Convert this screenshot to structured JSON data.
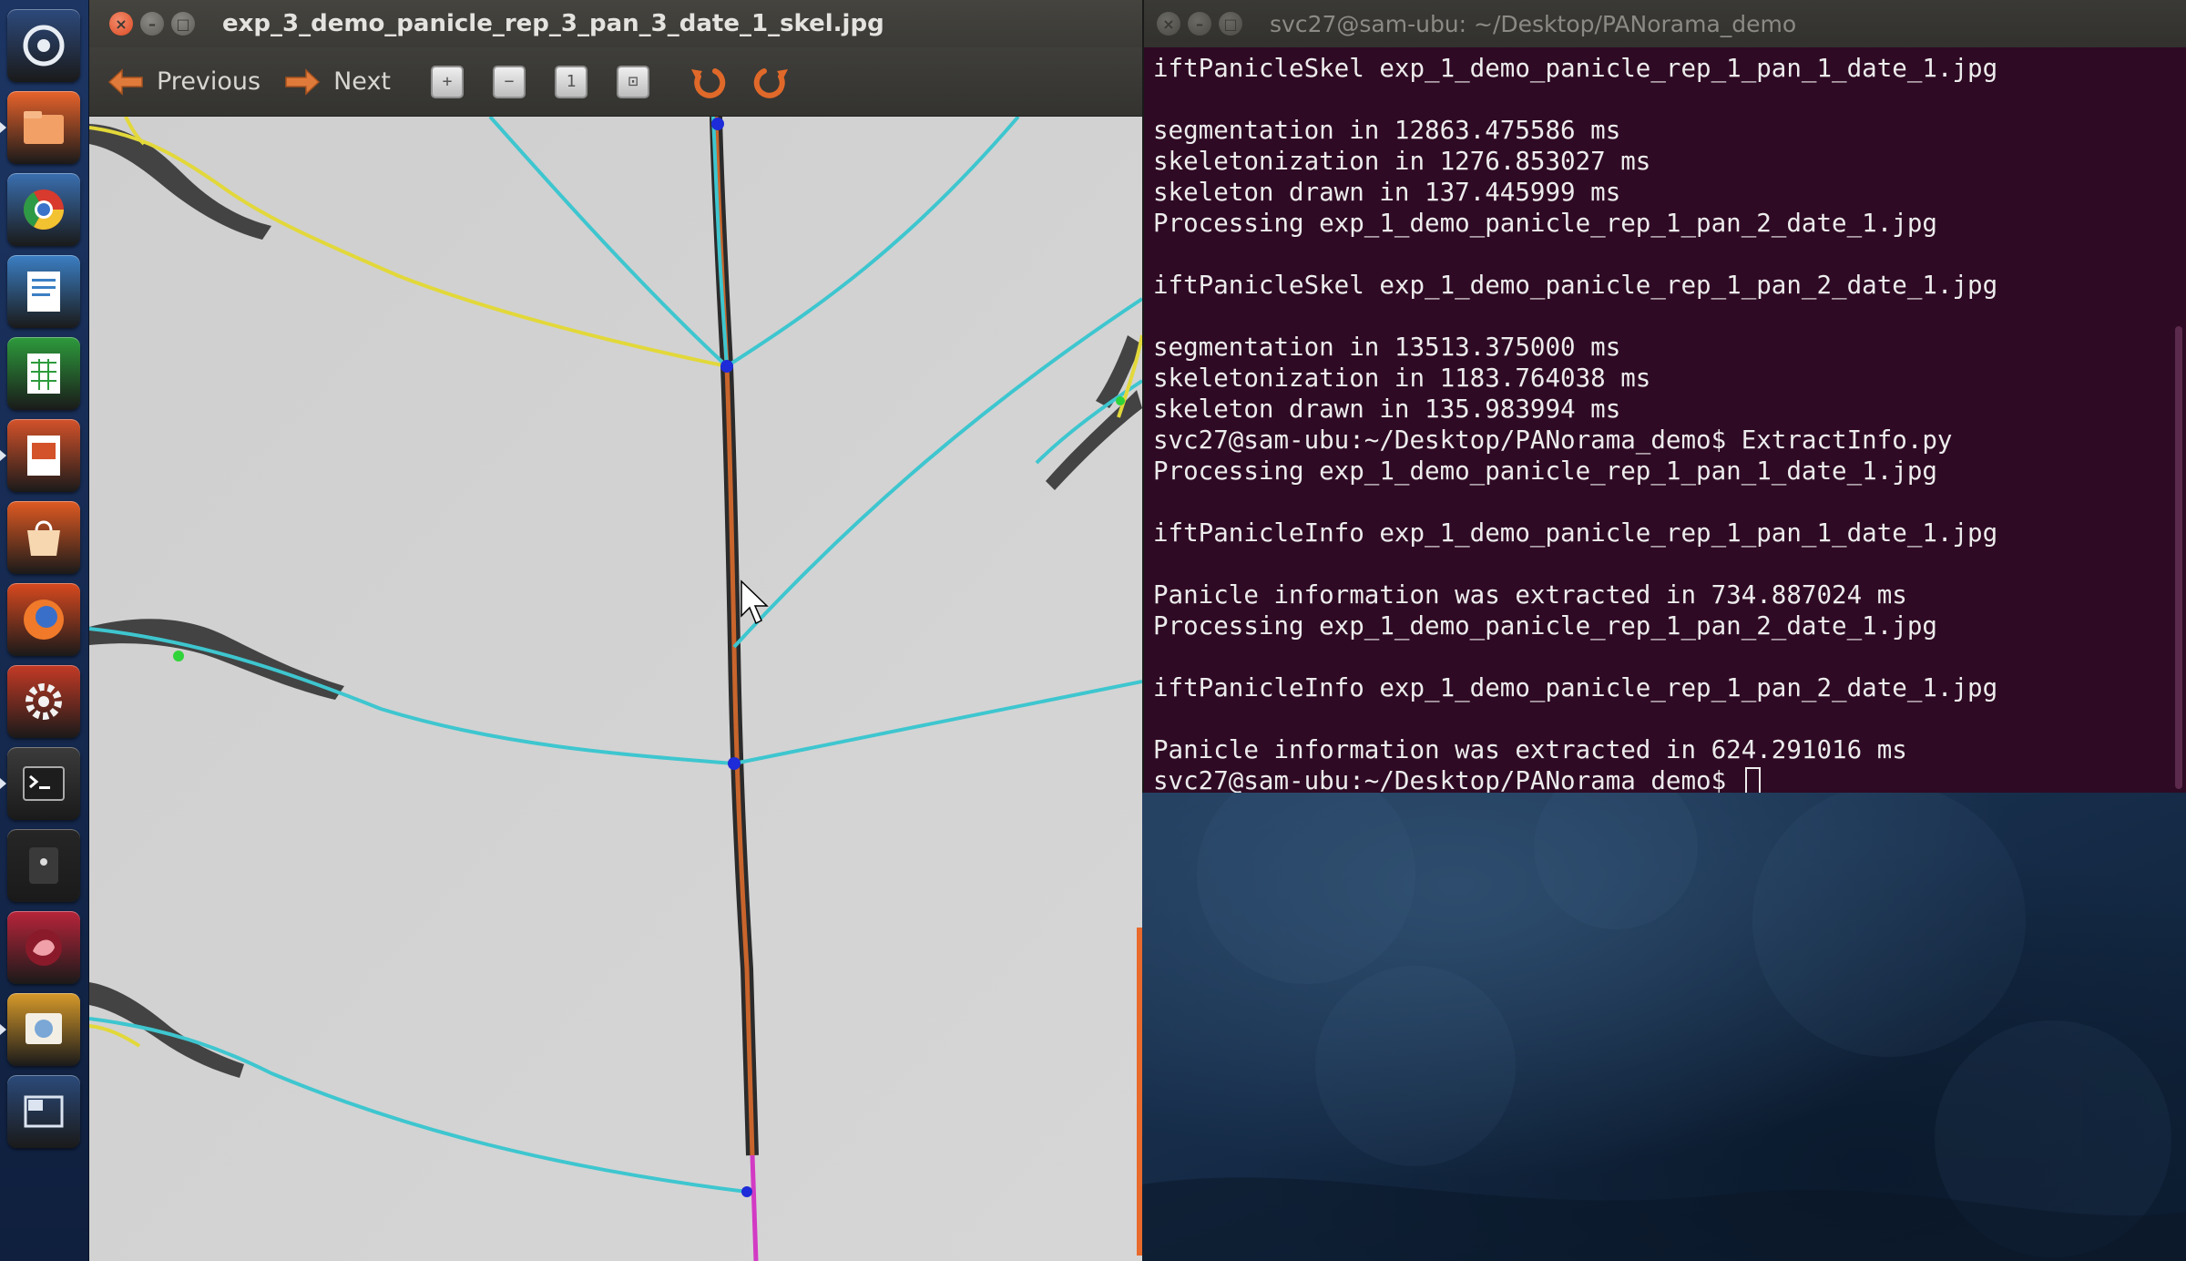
{
  "launcher": {
    "items": [
      {
        "name": "dash-home-icon",
        "color": "#2d4a7c"
      },
      {
        "name": "files-icon",
        "color": "#e8632b"
      },
      {
        "name": "chrome-icon",
        "color": "#3a6fb0"
      },
      {
        "name": "writer-icon",
        "color": "#3b7fc4"
      },
      {
        "name": "calc-icon",
        "color": "#2d9b3c"
      },
      {
        "name": "impress-icon",
        "color": "#d4522a"
      },
      {
        "name": "software-center-icon",
        "color": "#e05a22"
      },
      {
        "name": "firefox-icon",
        "color": "#d8491f"
      },
      {
        "name": "settings-icon",
        "color": "#c43a25"
      },
      {
        "name": "terminal-icon",
        "color": "#3b3b3b"
      },
      {
        "name": "camera-icon",
        "color": "#262626"
      },
      {
        "name": "app-icon",
        "color": "#b8243a"
      },
      {
        "name": "image-viewer-icon",
        "color": "#d79a2a"
      },
      {
        "name": "workspace-switcher-icon",
        "color": "#2b4a7a"
      }
    ]
  },
  "viewer": {
    "title": "exp_3_demo_panicle_rep_3_pan_3_date_1_skel.jpg",
    "toolbar": {
      "previous_label": "Previous",
      "next_label": "Next",
      "zoom_in_icon": "zoom-in-icon",
      "zoom_out_icon": "zoom-out-icon",
      "zoom_normal_icon": "zoom-normal-icon",
      "zoom_fit_icon": "zoom-fit-icon",
      "rotate_left_icon": "rotate-left-icon",
      "rotate_right_icon": "rotate-right-icon"
    },
    "colors": {
      "main_axis": "#c9652c",
      "primary_branch": "#3ec6cf",
      "secondary_branch": "#e2d83a",
      "node": "#1d2bd8",
      "end_point": "#2fd43a",
      "tail": "#d23ac4"
    }
  },
  "terminal": {
    "title": "svc27@sam-ubu: ~/Desktop/PANorama_demo",
    "lines": [
      "iftPanicleSkel exp_1_demo_panicle_rep_1_pan_1_date_1.jpg",
      "",
      "segmentation in 12863.475586 ms",
      "skeletonization in 1276.853027 ms",
      "skeleton drawn in 137.445999 ms",
      "Processing exp_1_demo_panicle_rep_1_pan_2_date_1.jpg",
      "",
      "iftPanicleSkel exp_1_demo_panicle_rep_1_pan_2_date_1.jpg",
      "",
      "segmentation in 13513.375000 ms",
      "skeletonization in 1183.764038 ms",
      "skeleton drawn in 135.983994 ms",
      "svc27@sam-ubu:~/Desktop/PANorama_demo$ ExtractInfo.py",
      "Processing exp_1_demo_panicle_rep_1_pan_1_date_1.jpg",
      "",
      "iftPanicleInfo exp_1_demo_panicle_rep_1_pan_1_date_1.jpg",
      "",
      "Panicle information was extracted in 734.887024 ms",
      "Processing exp_1_demo_panicle_rep_1_pan_2_date_1.jpg",
      "",
      "iftPanicleInfo exp_1_demo_panicle_rep_1_pan_2_date_1.jpg",
      "",
      "Panicle information was extracted in 624.291016 ms"
    ],
    "prompt": "svc27@sam-ubu:~/Desktop/PANorama_demo$ ",
    "background": "#2f0a24",
    "foreground": "#ececec"
  }
}
